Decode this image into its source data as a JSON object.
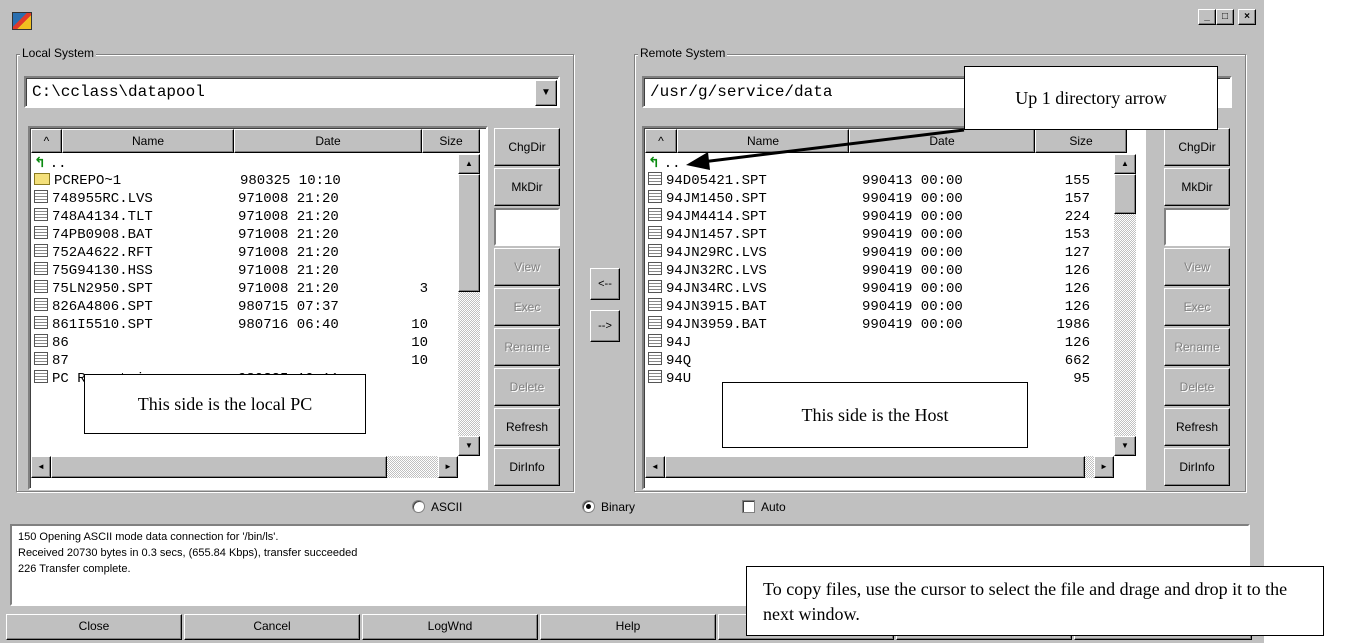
{
  "window": {
    "minimize": "_",
    "maximize": "□",
    "close": "×"
  },
  "local": {
    "group_label": "Local System",
    "path": "C:\\cclass\\datapool",
    "columns": {
      "sort": "^",
      "name": "Name",
      "date": "Date",
      "size": "Size"
    },
    "rows": [
      {
        "icon": "up",
        "name": "..",
        "date": "",
        "size": ""
      },
      {
        "icon": "folder",
        "name": "PCREPO~1",
        "date": "980325 10:10",
        "size": ""
      },
      {
        "icon": "file",
        "name": "748955RC.LVS",
        "date": "971008 21:20",
        "size": ""
      },
      {
        "icon": "file",
        "name": "748A4134.TLT",
        "date": "971008 21:20",
        "size": ""
      },
      {
        "icon": "file",
        "name": "74PB0908.BAT",
        "date": "971008 21:20",
        "size": ""
      },
      {
        "icon": "file",
        "name": "752A4622.RFT",
        "date": "971008 21:20",
        "size": ""
      },
      {
        "icon": "file",
        "name": "75G94130.HSS",
        "date": "971008 21:20",
        "size": ""
      },
      {
        "icon": "file",
        "name": "75LN2950.SPT",
        "date": "971008 21:20",
        "size": "3"
      },
      {
        "icon": "file",
        "name": "826A4806.SPT",
        "date": "980715 07:37",
        "size": ""
      },
      {
        "icon": "file",
        "name": "861I5510.SPT",
        "date": "980716 06:40",
        "size": "10"
      },
      {
        "icon": "file",
        "name": "86",
        "date": "",
        "size": "10"
      },
      {
        "icon": "file",
        "name": "87",
        "date": "",
        "size": "10"
      },
      {
        "icon": "file",
        "name": "PC Report.iwz",
        "date": "980325 10:11",
        "size": ""
      }
    ],
    "buttons": {
      "chgdir": "ChgDir",
      "mkdir": "MkDir",
      "view": "View",
      "exec": "Exec",
      "rename": "Rename",
      "delete": "Delete",
      "refresh": "Refresh",
      "dirinfo": "DirInfo"
    }
  },
  "remote": {
    "group_label": "Remote System",
    "path": "/usr/g/service/data",
    "columns": {
      "sort": "^",
      "name": "Name",
      "date": "Date",
      "size": "Size"
    },
    "rows": [
      {
        "icon": "up",
        "name": "..",
        "date": "",
        "size": ""
      },
      {
        "icon": "file",
        "name": "94D05421.SPT",
        "date": "990413 00:00",
        "size": "155"
      },
      {
        "icon": "file",
        "name": "94JM1450.SPT",
        "date": "990419 00:00",
        "size": "157"
      },
      {
        "icon": "file",
        "name": "94JM4414.SPT",
        "date": "990419 00:00",
        "size": "224"
      },
      {
        "icon": "file",
        "name": "94JN1457.SPT",
        "date": "990419 00:00",
        "size": "153"
      },
      {
        "icon": "file",
        "name": "94JN29RC.LVS",
        "date": "990419 00:00",
        "size": "127"
      },
      {
        "icon": "file",
        "name": "94JN32RC.LVS",
        "date": "990419 00:00",
        "size": "126"
      },
      {
        "icon": "file",
        "name": "94JN34RC.LVS",
        "date": "990419 00:00",
        "size": "126"
      },
      {
        "icon": "file",
        "name": "94JN3915.BAT",
        "date": "990419 00:00",
        "size": "126"
      },
      {
        "icon": "file",
        "name": "94JN3959.BAT",
        "date": "990419 00:00",
        "size": "1986"
      },
      {
        "icon": "file",
        "name": "94J",
        "date": "",
        "size": "126"
      },
      {
        "icon": "file",
        "name": "94Q",
        "date": "",
        "size": "662"
      },
      {
        "icon": "file",
        "name": "94U",
        "date": "",
        "size": "95"
      }
    ],
    "buttons": {
      "chgdir": "ChgDir",
      "mkdir": "MkDir",
      "view": "View",
      "exec": "Exec",
      "rename": "Rename",
      "delete": "Delete",
      "refresh": "Refresh",
      "dirinfo": "DirInfo"
    }
  },
  "transfer": {
    "to_local": "<--",
    "to_remote": "-->"
  },
  "mode": {
    "ascii": "ASCII",
    "binary": "Binary",
    "auto": "Auto",
    "selected": "Binary"
  },
  "log": [
    "150 Opening ASCII mode data connection for '/bin/ls'.",
    "Received 20730 bytes in 0.3 secs, (655.84 Kbps), transfer succeeded",
    "226 Transfer complete."
  ],
  "bottom_buttons": [
    "Close",
    "Cancel",
    "LogWnd",
    "Help"
  ],
  "annotations": {
    "up_arrow": "Up 1 directory arrow",
    "local": "This side is the local PC",
    "host": "This side is the Host",
    "copy": "To copy files, use the cursor to select the file and drage and drop it to the next window."
  }
}
